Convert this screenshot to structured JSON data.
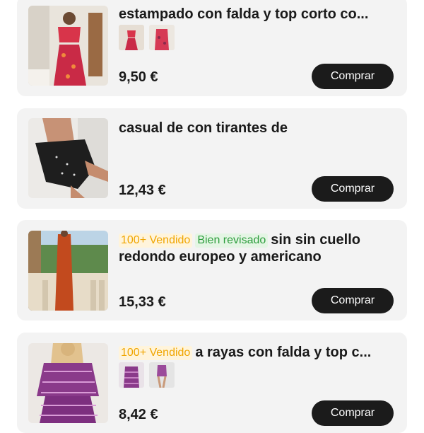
{
  "buy_label": "Comprar",
  "products": [
    {
      "title": "estampado con falda y top corto co...",
      "price": "9,50 €",
      "badges": []
    },
    {
      "title": "casual de con tirantes de",
      "price": "12,43 €",
      "badges": []
    },
    {
      "title": "sin sin cuello redondo europeo y americano",
      "price": "15,33 €",
      "badges": [
        "100+ Vendido",
        "Bien revisado"
      ]
    },
    {
      "title": "a rayas con falda y top c...",
      "price": "8,42 €",
      "badges": [
        "100+ Vendido"
      ]
    }
  ],
  "colors": {
    "card_bg": "#f3f3f3",
    "button_bg": "#1b1b1b",
    "sold_badge_text": "#f0a500",
    "sold_badge_bg": "#fff4db",
    "review_badge_text": "#2e9e3e",
    "review_badge_bg": "#e4f5e4"
  }
}
